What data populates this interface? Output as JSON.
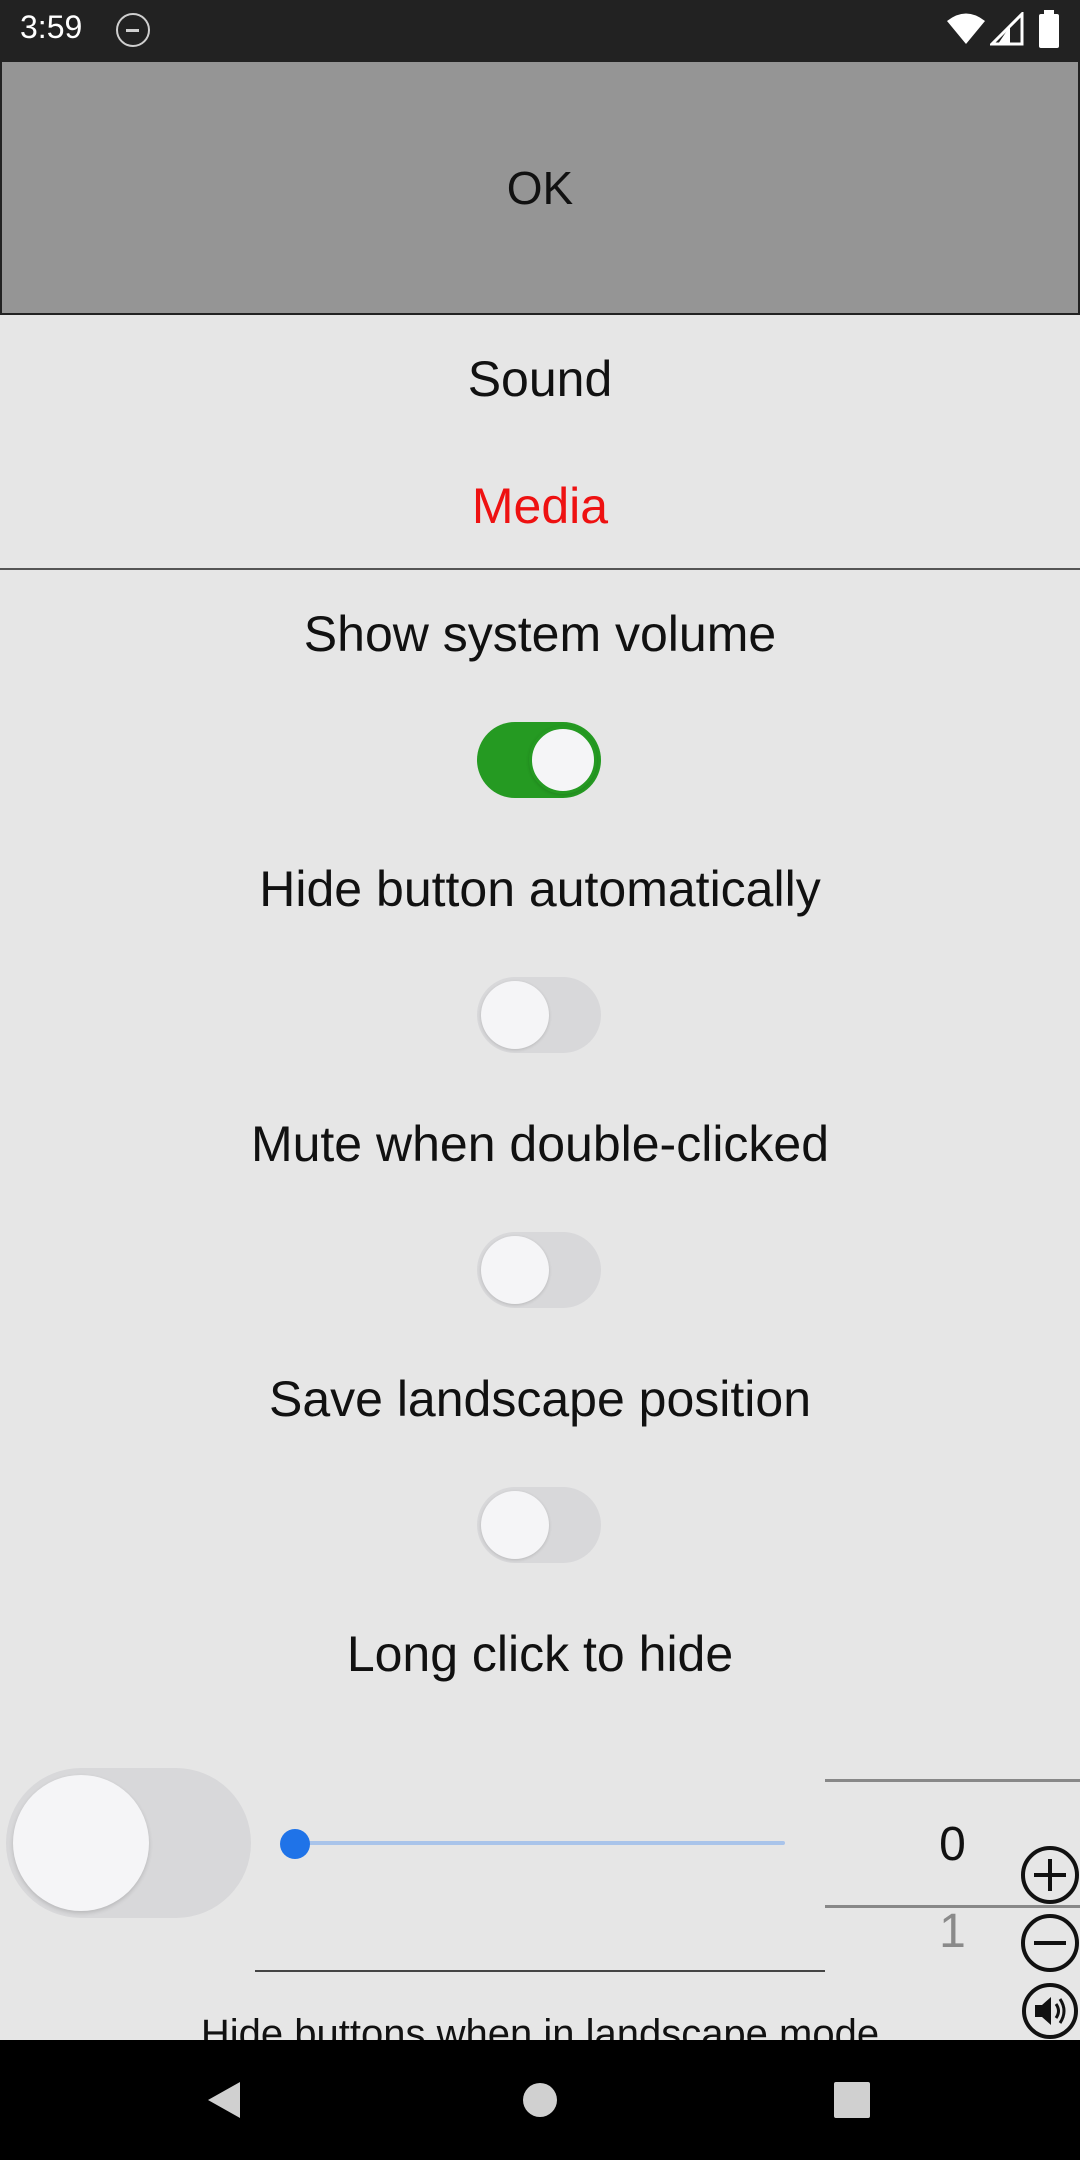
{
  "status_bar": {
    "time": "3:59",
    "icons": [
      "do-not-disturb-icon",
      "wifi-icon",
      "signal-icon",
      "battery-icon"
    ]
  },
  "ok_button": {
    "label": "OK"
  },
  "tabs": [
    {
      "label": "Sound",
      "selected": false
    },
    {
      "label": "Media",
      "selected": true,
      "color": "#ee1111"
    }
  ],
  "settings": [
    {
      "label": "Show system volume",
      "enabled": true
    },
    {
      "label": "Hide button automatically",
      "enabled": false
    },
    {
      "label": "Mute when double-clicked",
      "enabled": false
    },
    {
      "label": "Save landscape position",
      "enabled": false
    },
    {
      "label": "Long click to hide",
      "enabled": false
    }
  ],
  "controls": {
    "slider_value": 0,
    "picker_value": "0",
    "picker_next": "1",
    "plus_icon": "plus-circle-icon",
    "minus_icon": "minus-circle-icon",
    "speaker_icon": "speaker-icon"
  },
  "bottom_label": "Hide buttons when in landscape mode",
  "nav_bar": {
    "buttons": [
      "back-icon",
      "home-icon",
      "recents-icon"
    ]
  },
  "colors": {
    "accent_green": "#259a22",
    "slider_blue": "#1f73e8",
    "tab_red": "#ee1111"
  }
}
